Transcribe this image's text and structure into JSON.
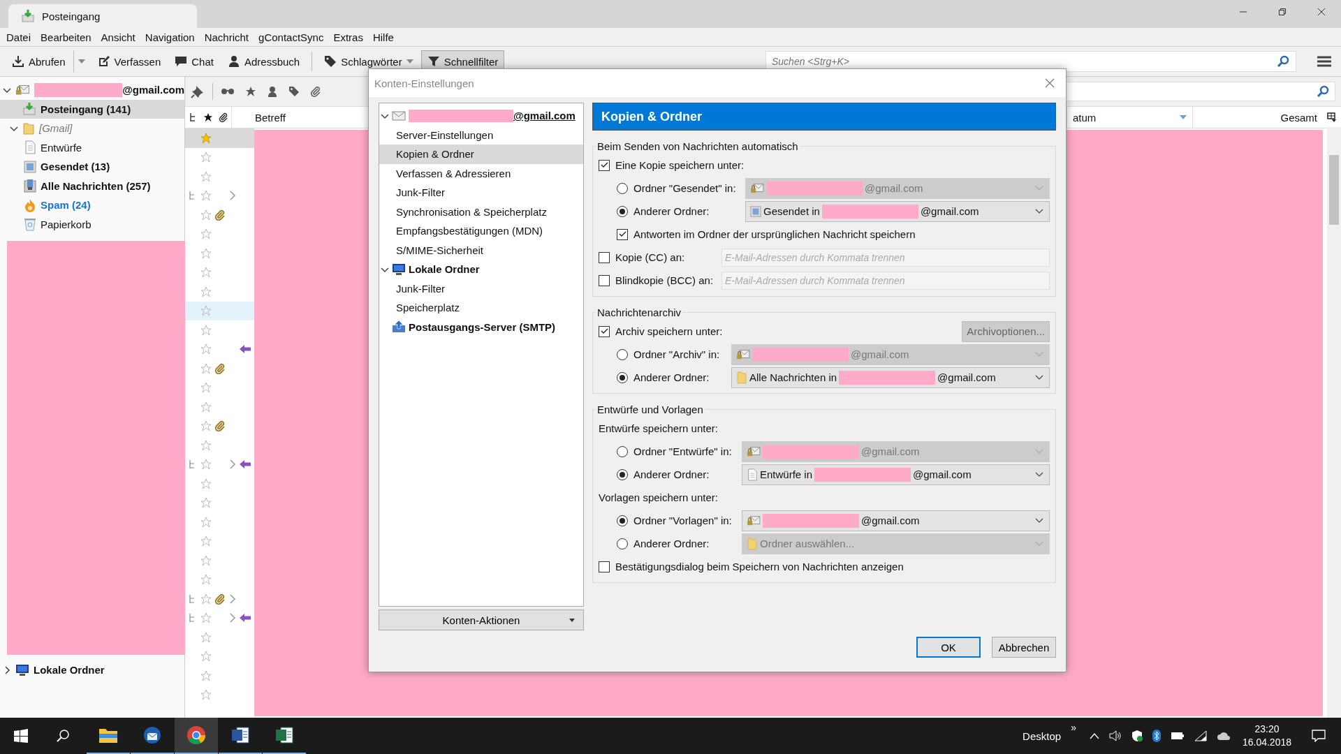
{
  "window": {
    "tab_title": "Posteingang"
  },
  "menu": [
    "Datei",
    "Bearbeiten",
    "Ansicht",
    "Navigation",
    "Nachricht",
    "gContactSync",
    "Extras",
    "Hilfe"
  ],
  "toolbar": [
    {
      "kind": "get",
      "label": "Abrufen",
      "pressed": false
    },
    {
      "kind": "write",
      "label": "Verfassen",
      "pressed": false
    },
    {
      "kind": "chat",
      "label": "Chat",
      "pressed": false
    },
    {
      "kind": "contacts",
      "label": "Adressbuch",
      "pressed": false
    },
    {
      "kind": "tags",
      "label": "Schlagwörter",
      "pressed": false
    },
    {
      "kind": "filter",
      "label": "Schnellfilter",
      "pressed": true
    }
  ],
  "search": {
    "placeholder": "Suchen <Strg+K>"
  },
  "folders": [
    {
      "kind": "account",
      "label": "@gmail.com",
      "redacted": true,
      "expanded": true,
      "children": [
        {
          "kind": "inbox",
          "label": "Posteingang (141)",
          "selected": true,
          "unread": true
        },
        {
          "kind": "gmail",
          "label": "[Gmail]",
          "selected": false,
          "unread": false,
          "expanded": true,
          "children": [
            {
              "kind": "drafts",
              "label": "Entwürfe",
              "selected": false,
              "unread": false
            },
            {
              "kind": "sent",
              "label": "Gesendet (13)",
              "selected": false,
              "unread": true
            },
            {
              "kind": "all",
              "label": "Alle Nachrichten (257)",
              "selected": false,
              "unread": true
            },
            {
              "kind": "spam",
              "label": "Spam (24)",
              "selected": false,
              "unread": true
            },
            {
              "kind": "trash",
              "label": "Papierkorb",
              "selected": false,
              "unread": false
            }
          ]
        }
      ]
    },
    {
      "kind": "local",
      "label": "Lokale Ordner",
      "redacted": false,
      "expanded": false
    }
  ],
  "columns": [
    {
      "kind": "thread"
    },
    {
      "kind": "star"
    },
    {
      "kind": "attachment"
    },
    {
      "kind": "text",
      "label": "Betreff",
      "sorted": false
    },
    {
      "kind": "text",
      "label": "atum",
      "sorted": true
    },
    {
      "kind": "text",
      "label": "Gesamt",
      "sorted": false
    }
  ],
  "rows": [
    {
      "selected": true,
      "hovered": false,
      "starred": true,
      "thread": false,
      "attachment": false,
      "replied": false
    },
    {
      "selected": false,
      "hovered": false,
      "starred": false,
      "thread": false,
      "attachment": false,
      "replied": false
    },
    {
      "selected": false,
      "hovered": false,
      "starred": false,
      "thread": false,
      "attachment": false,
      "replied": false
    },
    {
      "selected": false,
      "hovered": false,
      "starred": false,
      "thread": true,
      "attachment": false,
      "replied": false
    },
    {
      "selected": false,
      "hovered": false,
      "starred": false,
      "thread": false,
      "attachment": true,
      "replied": false
    },
    {
      "selected": false,
      "hovered": false,
      "starred": false,
      "thread": false,
      "attachment": false,
      "replied": false
    },
    {
      "selected": false,
      "hovered": false,
      "starred": false,
      "thread": false,
      "attachment": false,
      "replied": false
    },
    {
      "selected": false,
      "hovered": false,
      "starred": false,
      "thread": false,
      "attachment": false,
      "replied": false
    },
    {
      "selected": false,
      "hovered": false,
      "starred": false,
      "thread": false,
      "attachment": false,
      "replied": false
    },
    {
      "selected": false,
      "hovered": true,
      "starred": false,
      "thread": false,
      "attachment": false,
      "replied": false
    },
    {
      "selected": false,
      "hovered": false,
      "starred": false,
      "thread": false,
      "attachment": false,
      "replied": false
    },
    {
      "selected": false,
      "hovered": false,
      "starred": false,
      "thread": false,
      "attachment": false,
      "replied": true
    },
    {
      "selected": false,
      "hovered": false,
      "starred": false,
      "thread": false,
      "attachment": true,
      "replied": false
    },
    {
      "selected": false,
      "hovered": false,
      "starred": false,
      "thread": false,
      "attachment": false,
      "replied": false
    },
    {
      "selected": false,
      "hovered": false,
      "starred": false,
      "thread": false,
      "attachment": false,
      "replied": false
    },
    {
      "selected": false,
      "hovered": false,
      "starred": false,
      "thread": false,
      "attachment": true,
      "replied": false
    },
    {
      "selected": false,
      "hovered": false,
      "starred": false,
      "thread": false,
      "attachment": false,
      "replied": false
    },
    {
      "selected": false,
      "hovered": false,
      "starred": false,
      "thread": true,
      "attachment": false,
      "replied": true
    },
    {
      "selected": false,
      "hovered": false,
      "starred": false,
      "thread": false,
      "attachment": false,
      "replied": false
    },
    {
      "selected": false,
      "hovered": false,
      "starred": false,
      "thread": false,
      "attachment": false,
      "replied": false
    },
    {
      "selected": false,
      "hovered": false,
      "starred": false,
      "thread": false,
      "attachment": false,
      "replied": false
    },
    {
      "selected": false,
      "hovered": false,
      "starred": false,
      "thread": false,
      "attachment": false,
      "replied": false
    },
    {
      "selected": false,
      "hovered": false,
      "starred": false,
      "thread": false,
      "attachment": false,
      "replied": false
    },
    {
      "selected": false,
      "hovered": false,
      "starred": false,
      "thread": false,
      "attachment": false,
      "replied": false
    },
    {
      "selected": false,
      "hovered": false,
      "starred": false,
      "thread": true,
      "attachment": true,
      "replied": false
    },
    {
      "selected": false,
      "hovered": false,
      "starred": false,
      "thread": true,
      "attachment": false,
      "replied": true
    },
    {
      "selected": false,
      "hovered": false,
      "starred": false,
      "thread": false,
      "attachment": false,
      "replied": false
    },
    {
      "selected": false,
      "hovered": false,
      "starred": false,
      "thread": false,
      "attachment": false,
      "replied": false
    },
    {
      "selected": false,
      "hovered": false,
      "starred": false,
      "thread": false,
      "attachment": false,
      "replied": false
    },
    {
      "selected": false,
      "hovered": false,
      "starred": false,
      "thread": false,
      "attachment": false,
      "replied": false
    }
  ],
  "dialog": {
    "title": "Konten-Einstellungen",
    "tree": [
      {
        "kind": "account",
        "label": "@gmail.com",
        "redacted": true,
        "expanded": true,
        "children": [
          {
            "label": "Server-Einstellungen",
            "selected": false
          },
          {
            "label": "Kopien & Ordner",
            "selected": true
          },
          {
            "label": "Verfassen & Adressieren",
            "selected": false
          },
          {
            "label": "Junk-Filter",
            "selected": false
          },
          {
            "label": "Synchronisation & Speicherplatz",
            "selected": false
          },
          {
            "label": "Empfangsbestätigungen (MDN)",
            "selected": false
          },
          {
            "label": "S/MIME-Sicherheit",
            "selected": false
          }
        ]
      },
      {
        "kind": "local",
        "label": "Lokale Ordner",
        "redacted": false,
        "expanded": true,
        "children": [
          {
            "label": "Junk-Filter",
            "selected": false
          },
          {
            "label": "Speicherplatz",
            "selected": false
          }
        ]
      },
      {
        "kind": "smtp",
        "label": "Postausgangs-Server (SMTP)",
        "redacted": false
      }
    ],
    "actions_button": "Konten-Aktionen",
    "heading": "Kopien & Ordner",
    "sections": [
      {
        "legend": "Beim Senden von Nachrichten automatisch",
        "rows": [
          {
            "kind": "checkbox",
            "label": "Eine Kopie speichern unter:",
            "checked": true
          },
          {
            "kind": "radio",
            "label": "Ordner \"Gesendet\" in:",
            "selected": false,
            "select": {
              "kind": "account",
              "redacted": true,
              "suffix": "@gmail.com",
              "disabled": true
            }
          },
          {
            "kind": "radio",
            "label": "Anderer Ordner:",
            "selected": true,
            "select": {
              "kind": "sent",
              "text": "Gesendet in",
              "redacted": true,
              "suffix": "@gmail.com",
              "disabled": false
            }
          },
          {
            "kind": "subcheckbox",
            "label": "Antworten im Ordner der ursprünglichen Nachricht speichern",
            "checked": true
          },
          {
            "kind": "field",
            "label": "Kopie (CC) an:",
            "checked": false,
            "placeholder": "E-Mail-Adressen durch Kommata trennen"
          },
          {
            "kind": "field",
            "label": "Blindkopie (BCC) an:",
            "checked": false,
            "placeholder": "E-Mail-Adressen durch Kommata trennen"
          }
        ]
      },
      {
        "legend": "Nachrichtenarchiv",
        "rows": [
          {
            "kind": "checkbox",
            "label": "Archiv speichern unter:",
            "checked": true,
            "button": "Archivoptionen..."
          },
          {
            "kind": "radio",
            "label": "Ordner \"Archiv\" in:",
            "selected": false,
            "select": {
              "kind": "account",
              "redacted": true,
              "suffix": "@gmail.com",
              "disabled": true
            }
          },
          {
            "kind": "radio",
            "label": "Anderer Ordner:",
            "selected": true,
            "select": {
              "kind": "folder",
              "text": "Alle Nachrichten in",
              "redacted": true,
              "suffix": "@gmail.com",
              "disabled": false
            }
          }
        ]
      },
      {
        "legend": "Entwürfe und Vorlagen",
        "rows": [
          {
            "kind": "label",
            "label": "Entwürfe speichern unter:"
          },
          {
            "kind": "radio",
            "label": "Ordner \"Entwürfe\" in:",
            "selected": false,
            "select": {
              "kind": "account",
              "redacted": true,
              "suffix": "@gmail.com",
              "disabled": true
            }
          },
          {
            "kind": "radio",
            "label": "Anderer Ordner:",
            "selected": true,
            "select": {
              "kind": "drafts",
              "text": "Entwürfe in",
              "redacted": true,
              "suffix": "@gmail.com",
              "disabled": false
            }
          },
          {
            "kind": "label",
            "label": "Vorlagen speichern unter:"
          },
          {
            "kind": "radio",
            "label": "Ordner \"Vorlagen\" in:",
            "selected": true,
            "select": {
              "kind": "account",
              "redacted": true,
              "suffix": "@gmail.com",
              "disabled": false
            }
          },
          {
            "kind": "radio",
            "label": "Anderer Ordner:",
            "selected": false,
            "select": {
              "kind": "folder",
              "text": "Ordner auswählen...",
              "redacted": false,
              "disabled": true
            }
          },
          {
            "kind": "checkbox",
            "label": "Bestätigungsdialog beim Speichern von Nachrichten anzeigen",
            "checked": false
          }
        ]
      }
    ],
    "buttons": [
      {
        "label": "OK",
        "default": true
      },
      {
        "label": "Abbrechen",
        "default": false
      }
    ]
  },
  "taskbar": {
    "apps": [
      {
        "kind": "explorer",
        "active": false
      },
      {
        "kind": "mail",
        "active": false
      },
      {
        "kind": "browser",
        "active": true
      },
      {
        "kind": "word",
        "active": false
      },
      {
        "kind": "excel",
        "active": false
      }
    ],
    "desktop": "Desktop",
    "overflow": "»",
    "time": "23:20",
    "date": "16.04.2018"
  }
}
